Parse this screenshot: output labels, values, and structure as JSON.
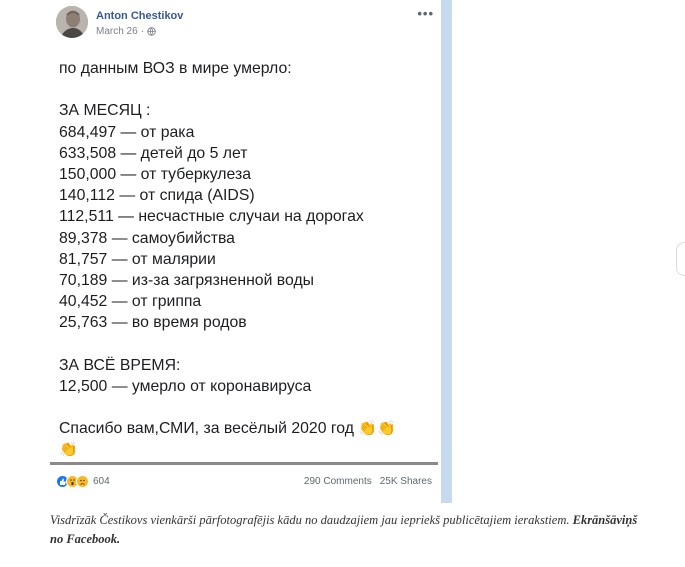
{
  "post": {
    "author": "Anton Chestikov",
    "date": "March 26",
    "privacy_separator": "·",
    "more_label": "•••",
    "body_lines": [
      "по данным ВОЗ в мире умерло:",
      "",
      "ЗА МЕСЯЦ :",
      "684,497 — от рака",
      "633,508 — детей до 5 лет",
      "150,000 — от туберкулеза",
      "140,112 — от спида (AIDS)",
      "112,511 — несчастные случаи на дорогах",
      "89,378 — самоубийства",
      "81,757 — от малярии",
      "70,189 — из-за загрязненной воды",
      "40,452 — от гриппа",
      "25,763 — во время родов",
      "",
      "ЗА ВСЁ ВРЕМЯ:",
      "12,500 — умерло от коронавируса",
      ""
    ],
    "closing_text": "Спасибо вам,СМИ, за весёлый 2020 год",
    "closing_emoji": "👏👏",
    "closing_emoji_2": "👏"
  },
  "footer": {
    "reaction_icons": [
      "like-icon",
      "wow-icon",
      "sad-icon"
    ],
    "reaction_count": "604",
    "comments": "290 Comments",
    "shares": "25K Shares"
  },
  "caption": {
    "text": "Visdrīzāk Čestikovs vienkārši pārfotografējis kādu no daudzajiem jau iepriekš publicētajiem ierakstiem.",
    "bold_text": "Ekrānšāviņš no Facebook."
  },
  "colors": {
    "author": "#385898",
    "accent_bar": "#c6d9ef",
    "like": "#1877f2",
    "emoji": "#f7b928"
  }
}
